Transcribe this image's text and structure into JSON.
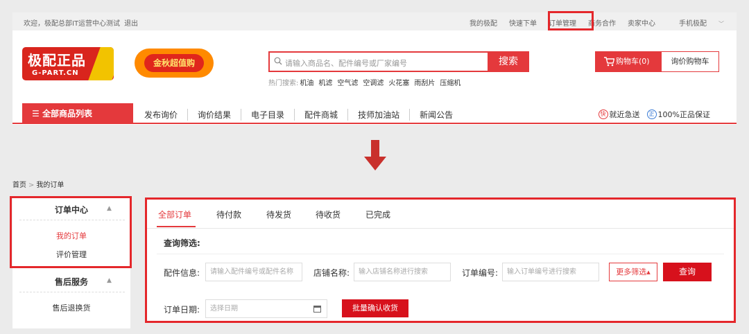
{
  "topbar": {
    "welcome": "欢迎，极配总部IT运营中心测试",
    "logout": "退出",
    "links": [
      "我的极配",
      "快速下单",
      "订单管理",
      "商务合作",
      "卖家中心",
      "手机极配"
    ]
  },
  "logo": {
    "cn": "极配正品",
    "en": "G-PART.CN"
  },
  "promo": {
    "label": "金秋超值购"
  },
  "search": {
    "placeholder": "请输入商品名、配件编号或厂家编号",
    "button": "搜索",
    "hot_label": "热门搜索:",
    "hot_keywords": [
      "机油",
      "机滤",
      "空气滤",
      "空调滤",
      "火花塞",
      "雨刮片",
      "压缩机"
    ]
  },
  "cart": {
    "label": "购物车(0)",
    "inquiry": "询价购物车"
  },
  "nav": {
    "all_categories": "全部商品列表",
    "items": [
      "发布询价",
      "询价结果",
      "电子目录",
      "配件商城",
      "技师加油站",
      "新闻公告"
    ],
    "badge1": "快",
    "assure1": "就近急送",
    "badge2": "正",
    "assure2": "100%正品保证"
  },
  "breadcrumb": {
    "home": "首页",
    "current": "我的订单"
  },
  "sidebar": {
    "order_center": "订单中心",
    "my_orders": "我的订单",
    "reviews": "评价管理",
    "after_sales": "售后服务",
    "returns": "售后退换货"
  },
  "orders": {
    "tabs": [
      "全部订单",
      "待付款",
      "待发货",
      "待收货",
      "已完成"
    ],
    "filter_title": "查询筛选:",
    "part_label": "配件信息:",
    "part_placeholder": "请输入配件编号或配件名称",
    "shop_label": "店铺名称:",
    "shop_placeholder": "输入店铺名称进行搜索",
    "order_label": "订单编号:",
    "order_placeholder": "输入订单编号进行搜索",
    "more_filter": "更多筛选▴",
    "query": "查询",
    "date_label": "订单日期:",
    "date_placeholder": "选择日期",
    "batch_confirm": "批量确认收货"
  },
  "colors": {
    "brand_red": "#e4393c",
    "highlight_red": "#e4272b"
  }
}
